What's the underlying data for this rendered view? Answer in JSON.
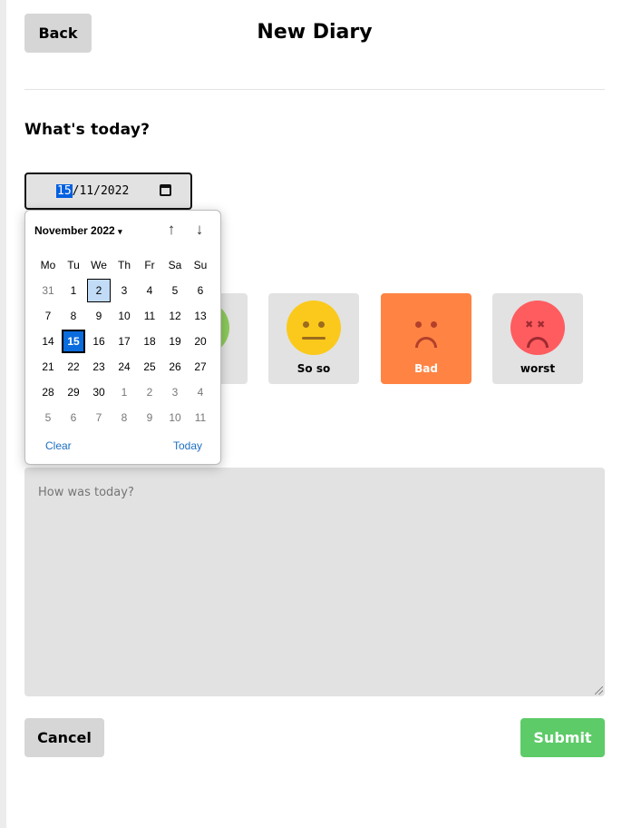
{
  "header": {
    "back_label": "Back",
    "title": "New Diary"
  },
  "section": {
    "today_title": "What's today?"
  },
  "date_input": {
    "day": "15",
    "rest": "/11/2022"
  },
  "emotions": [
    {
      "label": "",
      "color": "#8cc95b"
    },
    {
      "label": "So so",
      "color": "#fbc91b"
    },
    {
      "label": "Bad",
      "color": "#f1805f",
      "selected": true,
      "card_color": "#ff8444"
    },
    {
      "label": "worst",
      "color": "#ff5c60"
    }
  ],
  "diary": {
    "placeholder": "How was today?"
  },
  "actions": {
    "cancel_label": "Cancel",
    "submit_label": "Submit"
  },
  "calendar": {
    "month_label": "November 2022",
    "caret": "▾",
    "prev_icon": "↑",
    "next_icon": "↓",
    "weekdays": [
      "Mo",
      "Tu",
      "We",
      "Th",
      "Fr",
      "Sa",
      "Su"
    ],
    "weeks": [
      [
        "31",
        "1",
        "2",
        "3",
        "4",
        "5",
        "6"
      ],
      [
        "7",
        "8",
        "9",
        "10",
        "11",
        "12",
        "13"
      ],
      [
        "14",
        "15",
        "16",
        "17",
        "18",
        "19",
        "20"
      ],
      [
        "21",
        "22",
        "23",
        "24",
        "25",
        "26",
        "27"
      ],
      [
        "28",
        "29",
        "30",
        "1",
        "2",
        "3",
        "4"
      ],
      [
        "5",
        "6",
        "7",
        "8",
        "9",
        "10",
        "11"
      ]
    ],
    "clear_label": "Clear",
    "today_label": "Today"
  }
}
